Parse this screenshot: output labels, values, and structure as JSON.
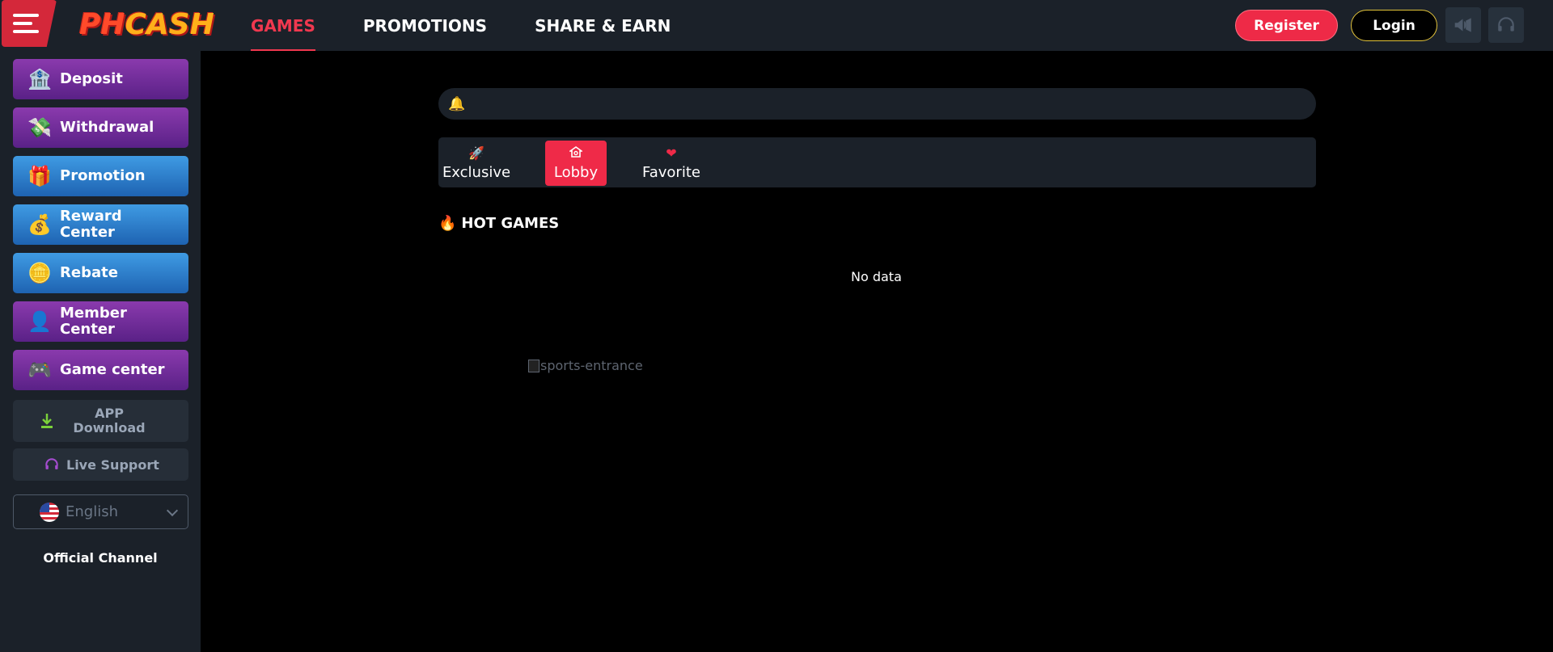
{
  "header": {
    "logo_text_a": "PH",
    "logo_text_b": "CASH",
    "nav": [
      "GAMES",
      "PROMOTIONS",
      "SHARE & EARN"
    ],
    "active_nav": "GAMES",
    "register_label": "Register",
    "login_label": "Login",
    "icons": [
      "menu-icon",
      "megaphone-icon",
      "headset-icon"
    ]
  },
  "sidebar": {
    "items": [
      {
        "label": "Deposit",
        "icon": "deposit-icon",
        "style": "purple"
      },
      {
        "label": "Withdrawal",
        "icon": "withdrawal-icon",
        "style": "purple"
      },
      {
        "label": "Promotion",
        "icon": "gift-icon",
        "style": "blue"
      },
      {
        "label": "Reward Center",
        "icon": "reward-icon",
        "style": "blue"
      },
      {
        "label": "Rebate",
        "icon": "rebate-icon",
        "style": "blue"
      },
      {
        "label": "Member Center",
        "icon": "member-icon",
        "style": "purple"
      },
      {
        "label": "Game center",
        "icon": "gamepad-icon",
        "style": "purple"
      }
    ],
    "app_download": "APP Download",
    "live_support": "Live Support",
    "language": "English",
    "official_channel": "Official Channel"
  },
  "main": {
    "notice_icon": "bell-icon",
    "tabs": [
      {
        "label": "Exclusive",
        "icon": "rocket-icon"
      },
      {
        "label": "Lobby",
        "icon": "lobby-icon"
      },
      {
        "label": "Favorite",
        "icon": "heart-icon"
      }
    ],
    "active_tab": "Lobby",
    "hot_games_title": "HOT GAMES",
    "no_data": "No data",
    "sports_image_alt": "sports-entrance"
  },
  "colors": {
    "accent": "#ee2a47",
    "panel": "#1b2129",
    "login_border": "#e2c33a"
  }
}
